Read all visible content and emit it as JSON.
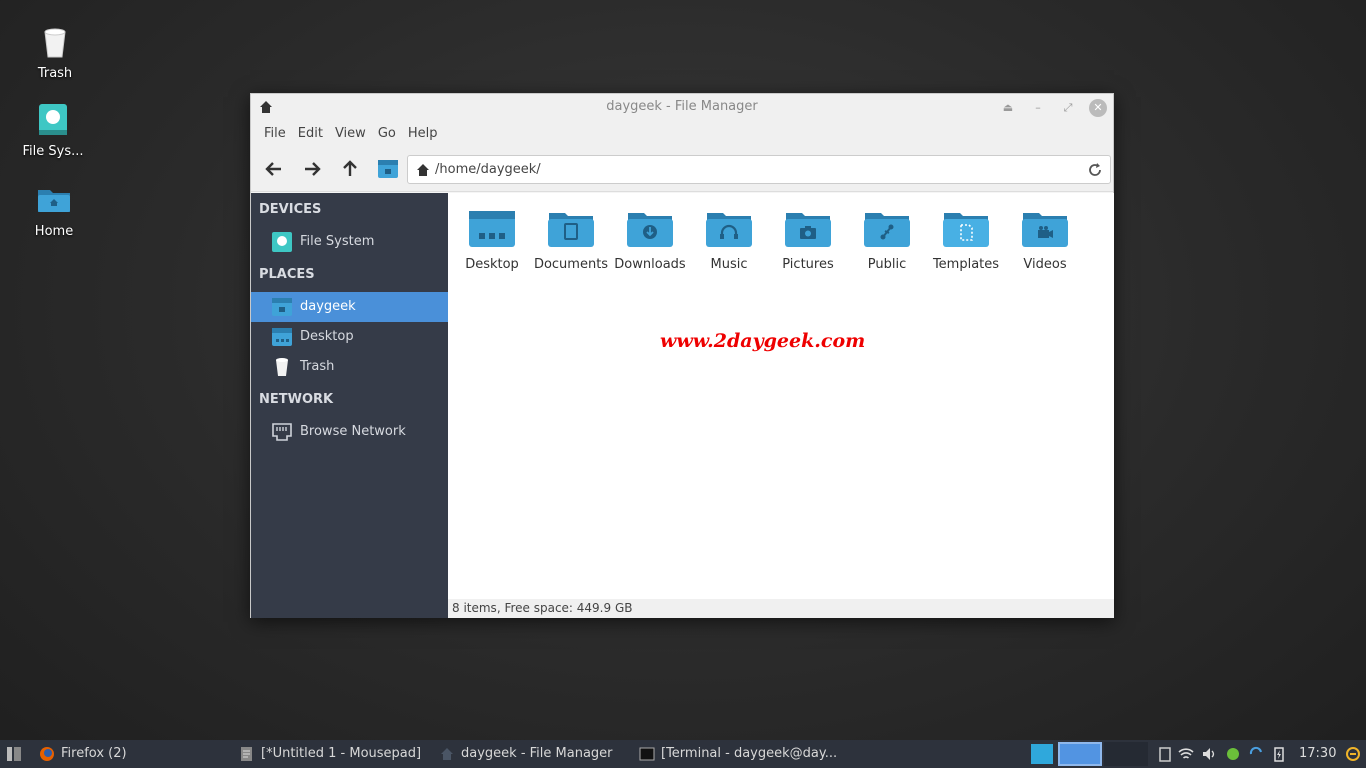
{
  "desktop": {
    "icons": [
      {
        "label": "Trash"
      },
      {
        "label": "File Sys..."
      },
      {
        "label": "Home"
      }
    ]
  },
  "window": {
    "title": "daygeek - File Manager",
    "menu": [
      "File",
      "Edit",
      "View",
      "Go",
      "Help"
    ],
    "path": "/home/daygeek/",
    "sidebar": {
      "devices_header": "DEVICES",
      "devices": [
        {
          "label": "File System"
        }
      ],
      "places_header": "PLACES",
      "places": [
        {
          "label": "daygeek",
          "active": true
        },
        {
          "label": "Desktop"
        },
        {
          "label": "Trash"
        }
      ],
      "network_header": "NETWORK",
      "network": [
        {
          "label": "Browse Network"
        }
      ]
    },
    "folders": [
      {
        "label": "Desktop",
        "icon": "desktop-folder-icon"
      },
      {
        "label": "Documents",
        "icon": "documents-folder-icon"
      },
      {
        "label": "Downloads",
        "icon": "downloads-folder-icon"
      },
      {
        "label": "Music",
        "icon": "music-folder-icon"
      },
      {
        "label": "Pictures",
        "icon": "pictures-folder-icon"
      },
      {
        "label": "Public",
        "icon": "public-folder-icon"
      },
      {
        "label": "Templates",
        "icon": "templates-folder-icon"
      },
      {
        "label": "Videos",
        "icon": "videos-folder-icon"
      }
    ],
    "watermark": "www.2daygeek.com",
    "status": "8 items, Free space: 449.9 GB"
  },
  "taskbar": {
    "tasks": [
      {
        "label": "Firefox (2)"
      },
      {
        "label": "[*Untitled 1 - Mousepad]"
      },
      {
        "label": "daygeek - File Manager"
      },
      {
        "label": "[Terminal - daygeek@day..."
      }
    ],
    "clock": "17:30"
  },
  "colors": {
    "folder": "#3fa3d8",
    "folder_dark": "#2b7fb0",
    "sidebar_bg": "#353b48",
    "selection": "#4a90d9"
  }
}
